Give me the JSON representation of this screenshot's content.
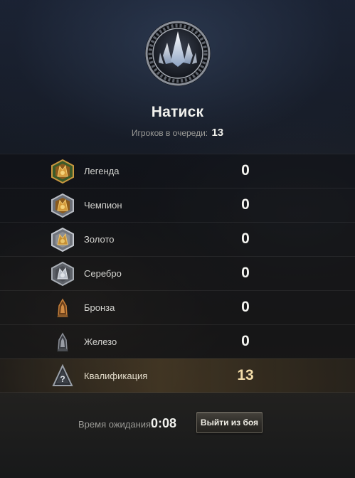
{
  "header": {
    "mode_title": "Натиск",
    "queue_label": "Игроков в очереди:",
    "queue_count": "13"
  },
  "leagues": [
    {
      "name": "Легенда",
      "count": "0",
      "icon": "legend-league-icon"
    },
    {
      "name": "Чемпион",
      "count": "0",
      "icon": "champion-league-icon"
    },
    {
      "name": "Золото",
      "count": "0",
      "icon": "gold-league-icon"
    },
    {
      "name": "Серебро",
      "count": "0",
      "icon": "silver-league-icon"
    },
    {
      "name": "Бронза",
      "count": "0",
      "icon": "bronze-league-icon"
    },
    {
      "name": "Железо",
      "count": "0",
      "icon": "iron-league-icon"
    },
    {
      "name": "Квалификация",
      "count": "13",
      "icon": "qualification-icon"
    }
  ],
  "footer": {
    "wait_label": "Время ожидания:",
    "wait_time": "0:08",
    "leave_button": "Выйти из боя"
  },
  "colors": {
    "highlight_count": "#f3dca8",
    "accent_gold": "#c9973f"
  }
}
